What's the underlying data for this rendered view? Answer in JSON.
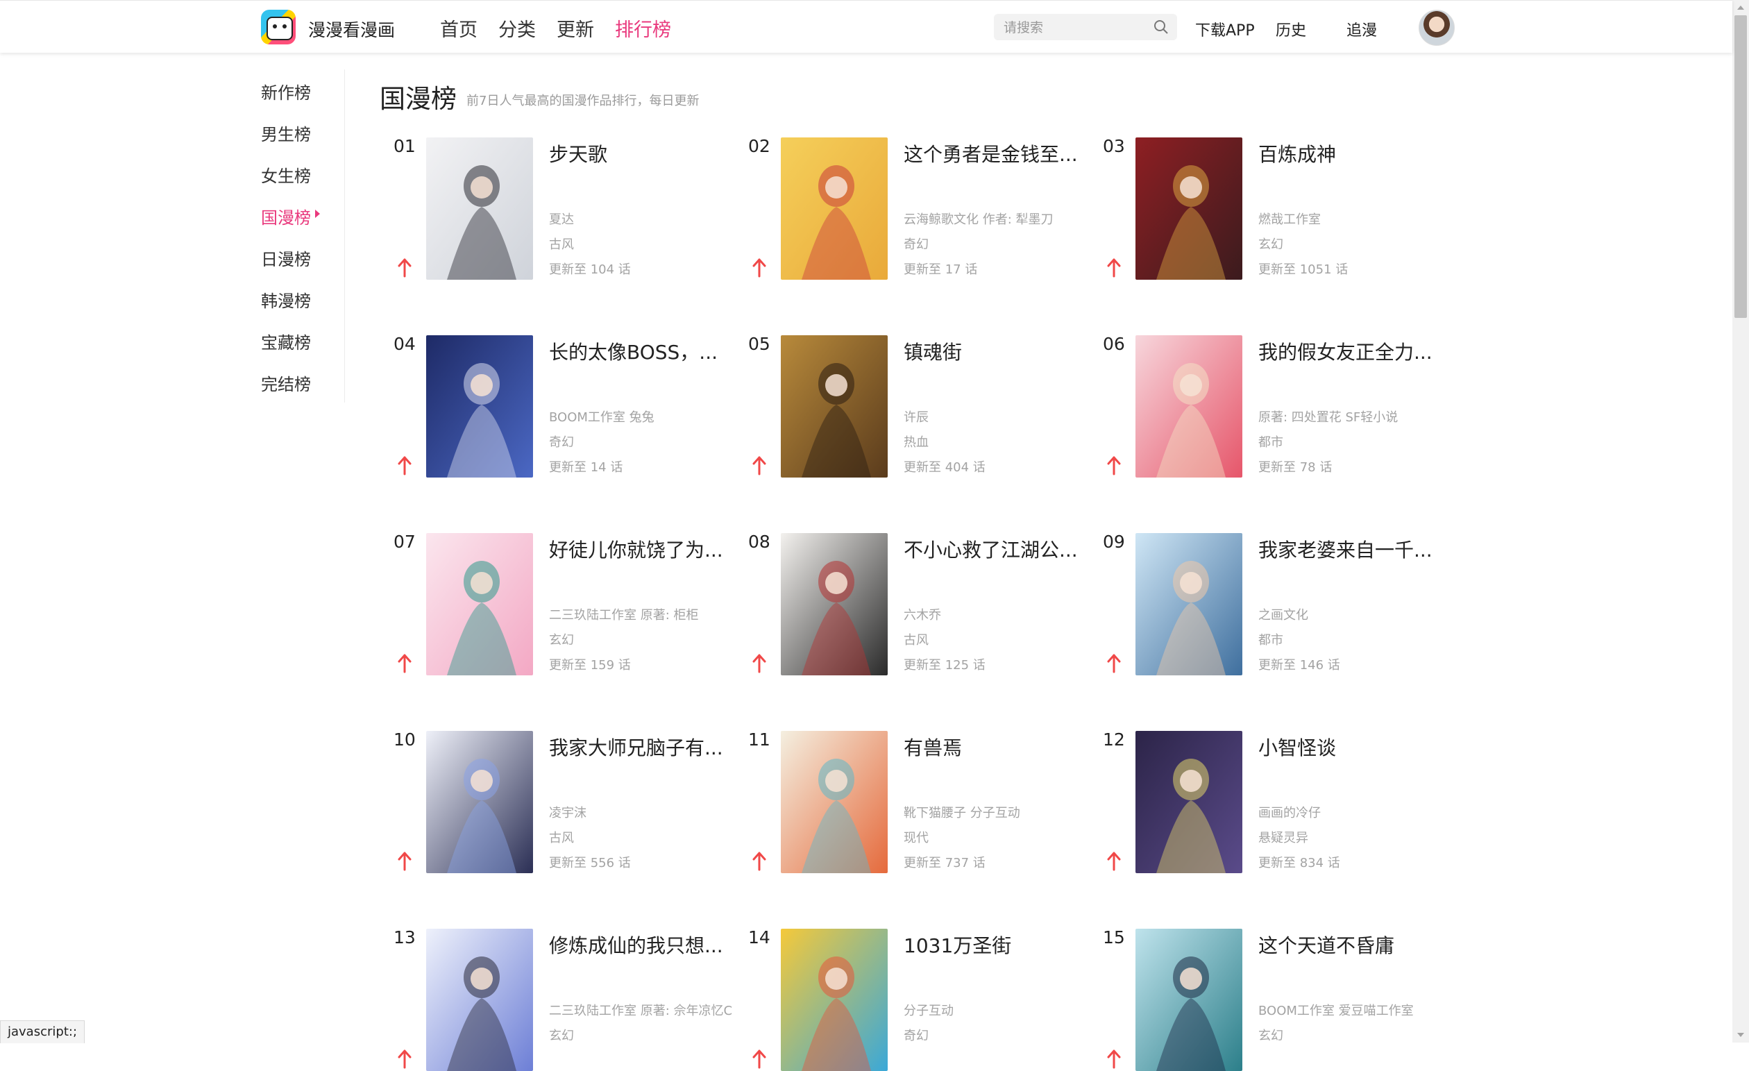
{
  "header": {
    "logo_text": "漫漫看漫画",
    "nav": [
      {
        "label": "首页",
        "active": false
      },
      {
        "label": "分类",
        "active": false
      },
      {
        "label": "更新",
        "active": false
      },
      {
        "label": "排行榜",
        "active": true
      }
    ],
    "search_placeholder": "请搜索",
    "links": [
      "下载APP",
      "历史",
      "追漫"
    ],
    "accent_color": "#e9397d"
  },
  "sidebar": {
    "items": [
      {
        "label": "新作榜",
        "active": false
      },
      {
        "label": "男生榜",
        "active": false
      },
      {
        "label": "女生榜",
        "active": false
      },
      {
        "label": "国漫榜",
        "active": true
      },
      {
        "label": "日漫榜",
        "active": false
      },
      {
        "label": "韩漫榜",
        "active": false
      },
      {
        "label": "宝藏榜",
        "active": false
      },
      {
        "label": "完结榜",
        "active": false
      }
    ]
  },
  "main": {
    "title": "国漫榜",
    "subtitle": "前7日人气最高的国漫作品排行，每日更新",
    "items": [
      {
        "rank": "01",
        "title": "步天歌",
        "author": "夏达",
        "genre": "古风",
        "update": "更新至 104 话",
        "trend": "up",
        "colors": [
          "#f2f2f4",
          "#cfd3da",
          "#2b2b33"
        ]
      },
      {
        "rank": "02",
        "title": "这个勇者是金钱至...",
        "author": "云海鲸歌文化 作者: 犁墨刀",
        "genre": "奇幻",
        "update": "更新至 17 话",
        "trend": "up",
        "colors": [
          "#f5cf5a",
          "#e9a93a",
          "#c93d3d"
        ]
      },
      {
        "rank": "03",
        "title": "百炼成神",
        "author": "燃哉工作室",
        "genre": "玄幻",
        "update": "更新至 1051 话",
        "trend": "up",
        "colors": [
          "#8e1f23",
          "#3b1b1e",
          "#d9a441"
        ]
      },
      {
        "rank": "04",
        "title": "长的太像BOSS，...",
        "author": "BOOM工作室 兔兔",
        "genre": "奇幻",
        "update": "更新至 14 话",
        "trend": "up",
        "colors": [
          "#1e2a66",
          "#4b68c4",
          "#d7dbef"
        ]
      },
      {
        "rank": "05",
        "title": "镇魂街",
        "author": "许辰",
        "genre": "热血",
        "update": "更新至 404 话",
        "trend": "up",
        "colors": [
          "#b88a3b",
          "#5a3b1c",
          "#2b1d12"
        ]
      },
      {
        "rank": "06",
        "title": "我的假女友正全力...",
        "author": "原著: 四处置花 SF轻小说",
        "genre": "都市",
        "update": "更新至 78 话",
        "trend": "up",
        "colors": [
          "#f7d6dc",
          "#e6566a",
          "#f4e0c4"
        ]
      },
      {
        "rank": "07",
        "title": "好徒儿你就饶了为...",
        "author": "二三玖陆工作室 原著: 柜柜",
        "genre": "玄幻",
        "update": "更新至 159 话",
        "trend": "up",
        "colors": [
          "#fbe6ee",
          "#f3a8c4",
          "#2d9b8b"
        ]
      },
      {
        "rank": "08",
        "title": "不小心救了江湖公...",
        "author": "六木乔",
        "genre": "古风",
        "update": "更新至 125 话",
        "trend": "up",
        "colors": [
          "#f3f1ee",
          "#2a2a2a",
          "#b43232"
        ]
      },
      {
        "rank": "09",
        "title": "我家老婆来自一千...",
        "author": "之画文化",
        "genre": "都市",
        "update": "更新至 146 话",
        "trend": "up",
        "colors": [
          "#cfe6f5",
          "#3f6f9e",
          "#f0c9a8"
        ]
      },
      {
        "rank": "10",
        "title": "我家大师兄脑子有...",
        "author": "凌宇沫",
        "genre": "古风",
        "update": "更新至 556 话",
        "trend": "up",
        "colors": [
          "#eef0f8",
          "#2b2f55",
          "#8aa3e6"
        ]
      },
      {
        "rank": "11",
        "title": "有兽焉",
        "author": "靴下猫腰子 分子互动",
        "genre": "现代",
        "update": "更新至 737 话",
        "trend": "up",
        "colors": [
          "#f4efe0",
          "#e56a3c",
          "#5fb8c9"
        ]
      },
      {
        "rank": "12",
        "title": "小智怪谈",
        "author": "画画的冷仔",
        "genre": "悬疑灵异",
        "update": "更新至 834 话",
        "trend": "up",
        "colors": [
          "#2c2448",
          "#5a4b8a",
          "#e0d36a"
        ]
      },
      {
        "rank": "13",
        "title": "修炼成仙的我只想...",
        "author": "二三玖陆工作室 原著: 佘年凉忆C",
        "genre": "玄幻",
        "update": "",
        "trend": "up",
        "colors": [
          "#eef1fb",
          "#6d7fd6",
          "#2a2a3a"
        ]
      },
      {
        "rank": "14",
        "title": "1031万圣街",
        "author": "分子互动",
        "genre": "奇幻",
        "update": "",
        "trend": "up",
        "colors": [
          "#f5c93a",
          "#3aa8d8",
          "#e5553d"
        ]
      },
      {
        "rank": "15",
        "title": "这个天道不昏庸",
        "author": "BOOM工作室 爱豆喵工作室",
        "genre": "玄幻",
        "update": "",
        "trend": "up",
        "colors": [
          "#bfe3ec",
          "#2c7f8a",
          "#1d2b46"
        ]
      }
    ]
  },
  "status_bar": {
    "text": "javascript:;"
  },
  "trend_color": "#f04848"
}
